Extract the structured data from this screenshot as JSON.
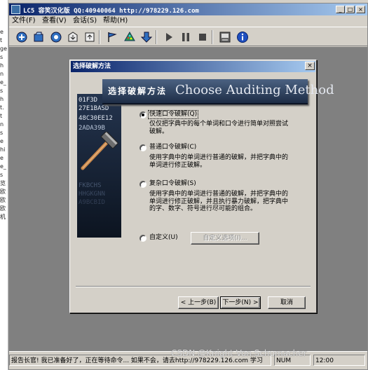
{
  "window": {
    "title": "LC5 容笑汉化版 QQ:40940064 http://978229.126.com",
    "controls": [
      "_",
      "□",
      "×"
    ]
  },
  "background_window": {
    "visible_fragments": [
      "e",
      "t",
      "ge",
      "s",
      "h",
      "n",
      "e_",
      "s",
      "h",
      "t.",
      "t",
      "n",
      "s",
      "e",
      "hi",
      "e",
      "e_",
      "s",
      "览",
      "欧",
      "欧",
      "欧",
      "机"
    ]
  },
  "menu": {
    "items": [
      "文件(F)",
      "查看(V)",
      "会话(S)",
      "帮助(H)"
    ]
  },
  "toolbar": {
    "buttons": [
      {
        "name": "session-wizard-icon"
      },
      {
        "name": "open-session-icon"
      },
      {
        "name": "session-options-icon"
      },
      {
        "name": "import-icon"
      },
      {
        "name": "export-icon"
      },
      {
        "name": "flag-icon"
      },
      {
        "name": "tree-icon"
      },
      {
        "name": "download-icon"
      },
      {
        "name": "play-icon"
      },
      {
        "name": "pause-icon"
      },
      {
        "name": "stop-icon"
      },
      {
        "name": "report-icon"
      },
      {
        "name": "info-icon"
      }
    ]
  },
  "status_bar": {
    "message": "报告长官! 我已准备好了，正在等待命令... 如果不会，请去http://978229.126.com 学习",
    "num": "NUM",
    "right": "12:00"
  },
  "dialog": {
    "title": "选择破解方法",
    "close": "×",
    "banner_cn": "选择破解方法",
    "banner_en": "Choose Auditing Method",
    "side_hex": [
      "01F3D",
      "27E1BASD",
      "48C30EE12",
      "2ADA39B",
      "",
      "",
      "",
      "FKBCHS",
      "HHGKGNN",
      "A9BCBID"
    ],
    "options": [
      {
        "label": "快速口令破解(Q)",
        "description": "仅仅把字典中的每个单词和口令进行简单对照尝试破解。",
        "selected": true
      },
      {
        "label": "普通口令破解(C)",
        "description": "使用字典中的单词进行普通的破解，并把字典中的单词进行修正破解。",
        "selected": false
      },
      {
        "label": "复杂口令破解(S)",
        "description": "使用字典中的单词进行普通的破解，并把字典中的单词进行修正破解，并且执行暴力破解，把字典中的字、数字、符号进行尽可能的组合。",
        "selected": false
      },
      {
        "label": "自定义(U)",
        "description": "",
        "selected": false
      }
    ],
    "custom_options_button": "自定义选项(I)...",
    "buttons": {
      "back": "< 上一步(B)",
      "next": "下一步(N) >",
      "cancel": "取消"
    }
  },
  "watermark": "CSDN @Knight Von Schumacher"
}
